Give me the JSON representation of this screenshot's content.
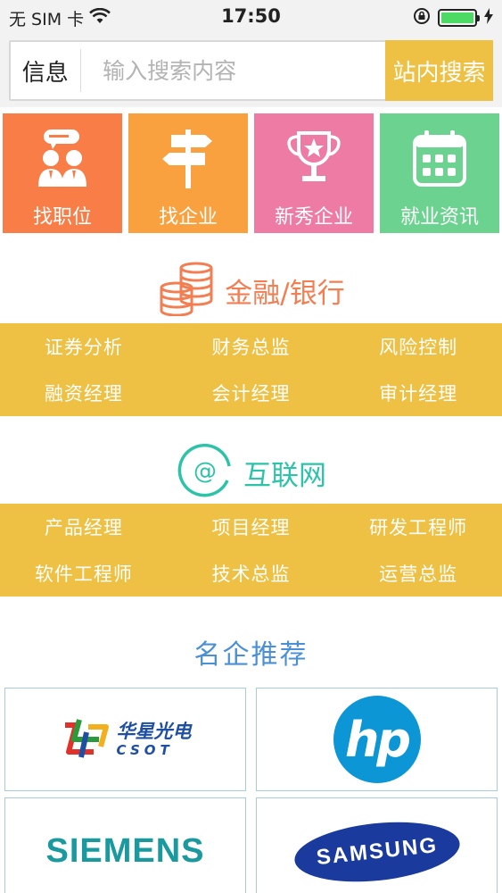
{
  "status": {
    "carrier": "无 SIM 卡",
    "time": "17:50",
    "battery_level": 1.0
  },
  "search": {
    "category": "信息",
    "placeholder": "输入搜索内容",
    "button_label": "站内搜索"
  },
  "tiles": [
    {
      "label": "找职位",
      "icon": "recruiter-icon",
      "color": "#f97d47"
    },
    {
      "label": "找企业",
      "icon": "signpost-icon",
      "color": "#f9a13f"
    },
    {
      "label": "新秀企业",
      "icon": "trophy-icon",
      "color": "#ed7ba3"
    },
    {
      "label": "就业资讯",
      "icon": "calendar-icon",
      "color": "#6cd28f"
    }
  ],
  "sections": [
    {
      "title": "金融/银行",
      "icon": "coins-icon",
      "color": "#f37e52",
      "items": [
        "证券分析",
        "财务总监",
        "风险控制",
        "融资经理",
        "会计经理",
        "审计经理"
      ]
    },
    {
      "title": "互联网",
      "icon": "at-sign-icon",
      "color": "#2cc3a8",
      "items": [
        "产品经理",
        "项目经理",
        "研发工程师",
        "软件工程师",
        "技术总监",
        "运营总监"
      ]
    }
  ],
  "recommend": {
    "title": "名企推荐",
    "logos": [
      {
        "name": "csot",
        "text_cn": "华星光电",
        "text_en": "CSOT"
      },
      {
        "name": "hp",
        "text": "hp"
      },
      {
        "name": "siemens",
        "text": "SIEMENS"
      },
      {
        "name": "samsung",
        "text": "SAMSUNG"
      }
    ]
  },
  "colors": {
    "band": "#eec043",
    "accent_blue": "#4a90d6"
  }
}
